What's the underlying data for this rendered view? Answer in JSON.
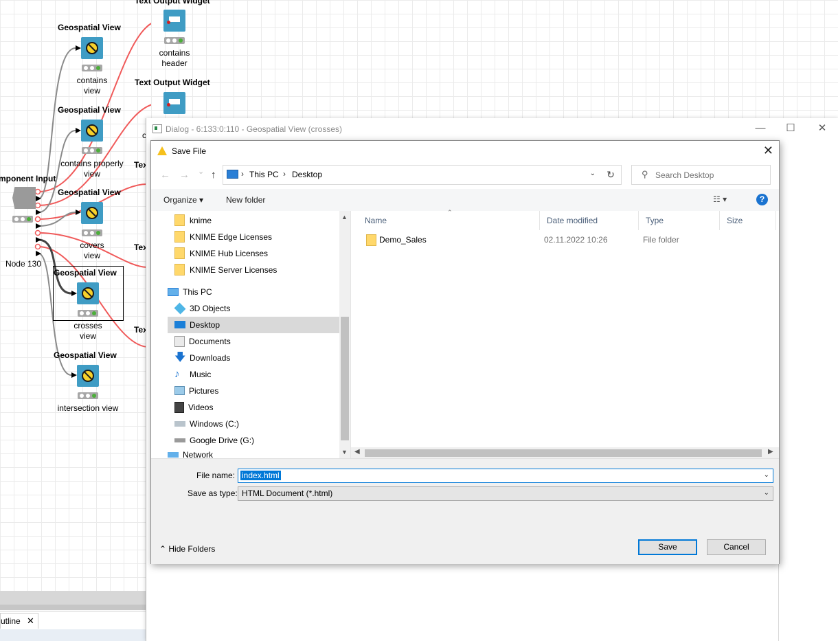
{
  "canvas": {
    "nodes": [
      {
        "title": "Text Output Widget",
        "label_lines": [
          "contains",
          "header"
        ]
      },
      {
        "title": "Geospatial View",
        "label_lines": [
          "contains",
          "view"
        ]
      },
      {
        "title": "Text Output Widget",
        "label_lines": [
          "c"
        ]
      },
      {
        "title": "Geospatial View",
        "label_lines": [
          "contains properly",
          "view"
        ]
      },
      {
        "title": "Geospatial View",
        "label_lines": [
          "covers",
          "view"
        ]
      },
      {
        "title": "Geospatial View",
        "label_lines": [
          "crosses",
          "view"
        ]
      },
      {
        "title": "Geospatial View",
        "label_lines": [
          "intersection view"
        ]
      }
    ],
    "component_input_title": "mponent Input",
    "component_node_label": "Node 130",
    "partial_labels": [
      "Tex",
      "Tex",
      "Tex"
    ],
    "outline_tab": "utline",
    "outline_close": "✕",
    "wire_colors": {
      "red": "#f05a5a",
      "gray": "#8a8a8a"
    }
  },
  "bg_dialog": {
    "title": "Dialog - 6:133:0:110 - Geospatial View (crosses)",
    "min": "—",
    "max": "☐",
    "close": "✕"
  },
  "save_dialog": {
    "title": "Save File",
    "close": "✕",
    "nav": {
      "back": "←",
      "forward": "→",
      "recent": "⌄",
      "up": "↑"
    },
    "breadcrumb": [
      "This PC",
      "Desktop"
    ],
    "breadcrumb_sep": "›",
    "address_dropdown": "⌄",
    "refresh": "↻",
    "search_placeholder": "Search Desktop",
    "toolbar": {
      "organize": "Organize ▾",
      "new_folder": "New folder",
      "view": "☷ ▾",
      "help": "?"
    },
    "tree": [
      {
        "label": "knime",
        "icon": "folder-icon"
      },
      {
        "label": "KNIME Edge Licenses",
        "icon": "folder-icon"
      },
      {
        "label": "KNIME Hub Licenses",
        "icon": "folder-icon"
      },
      {
        "label": "KNIME Server Licenses",
        "icon": "folder-icon"
      },
      {
        "label": "This PC",
        "icon": "this-pc-icon"
      },
      {
        "label": "3D Objects",
        "icon": "3d-objects-icon"
      },
      {
        "label": "Desktop",
        "icon": "desktop-icon",
        "selected": true
      },
      {
        "label": "Documents",
        "icon": "documents-icon"
      },
      {
        "label": "Downloads",
        "icon": "downloads-icon"
      },
      {
        "label": "Music",
        "icon": "music-icon"
      },
      {
        "label": "Pictures",
        "icon": "pictures-icon"
      },
      {
        "label": "Videos",
        "icon": "videos-icon"
      },
      {
        "label": "Windows (C:)",
        "icon": "drive-icon"
      },
      {
        "label": "Google Drive (G:)",
        "icon": "drive-icon"
      },
      {
        "label": "Network",
        "icon": "network-icon"
      }
    ],
    "columns": [
      "Name",
      "Date modified",
      "Type",
      "Size"
    ],
    "files": [
      {
        "name": "Demo_Sales",
        "date": "02.11.2022 10:26",
        "type": "File folder",
        "size": ""
      }
    ],
    "file_name_label": "File name:",
    "file_name_value": "index.html",
    "save_as_type_label": "Save as type:",
    "save_as_type_value": "HTML Document (*.html)",
    "hide_folders": "⌃  Hide Folders",
    "save": "Save",
    "cancel": "Cancel"
  }
}
